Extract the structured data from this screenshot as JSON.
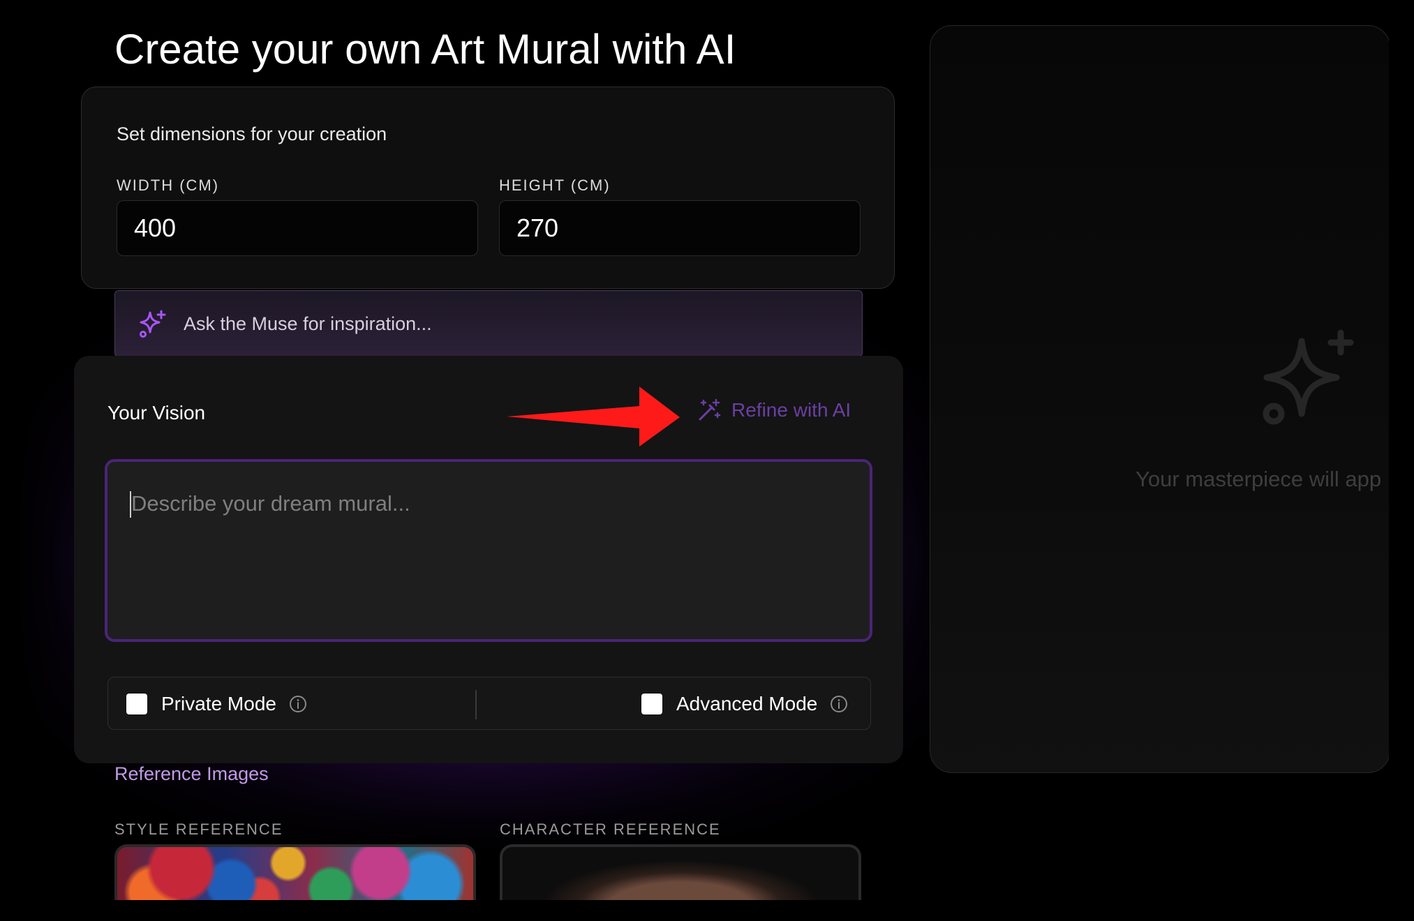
{
  "page": {
    "title": "Create your own Art Mural with AI"
  },
  "dimensions": {
    "heading": "Set dimensions for your creation",
    "width_label": "WIDTH (CM)",
    "width_value": "400",
    "height_label": "HEIGHT (CM)",
    "height_value": "270"
  },
  "muse": {
    "placeholder": "Ask the Muse for inspiration...",
    "icon": "sparkles-icon"
  },
  "vision": {
    "label": "Your Vision",
    "refine_label": "Refine with AI",
    "refine_icon": "magic-wand-icon",
    "placeholder": "Describe your dream mural..."
  },
  "modes": {
    "private_label": "Private Mode",
    "private_checked": false,
    "advanced_label": "Advanced Mode",
    "advanced_checked": false
  },
  "references": {
    "heading": "Reference Images",
    "style_label": "STYLE REFERENCE",
    "character_label": "CHARACTER REFERENCE"
  },
  "preview": {
    "message": "Your masterpiece will app",
    "icon": "sparkles-icon"
  },
  "colors": {
    "accent_purple": "#6b3fa3",
    "muse_icon": "#a855f7",
    "annotation_arrow": "#ff1a1a"
  }
}
